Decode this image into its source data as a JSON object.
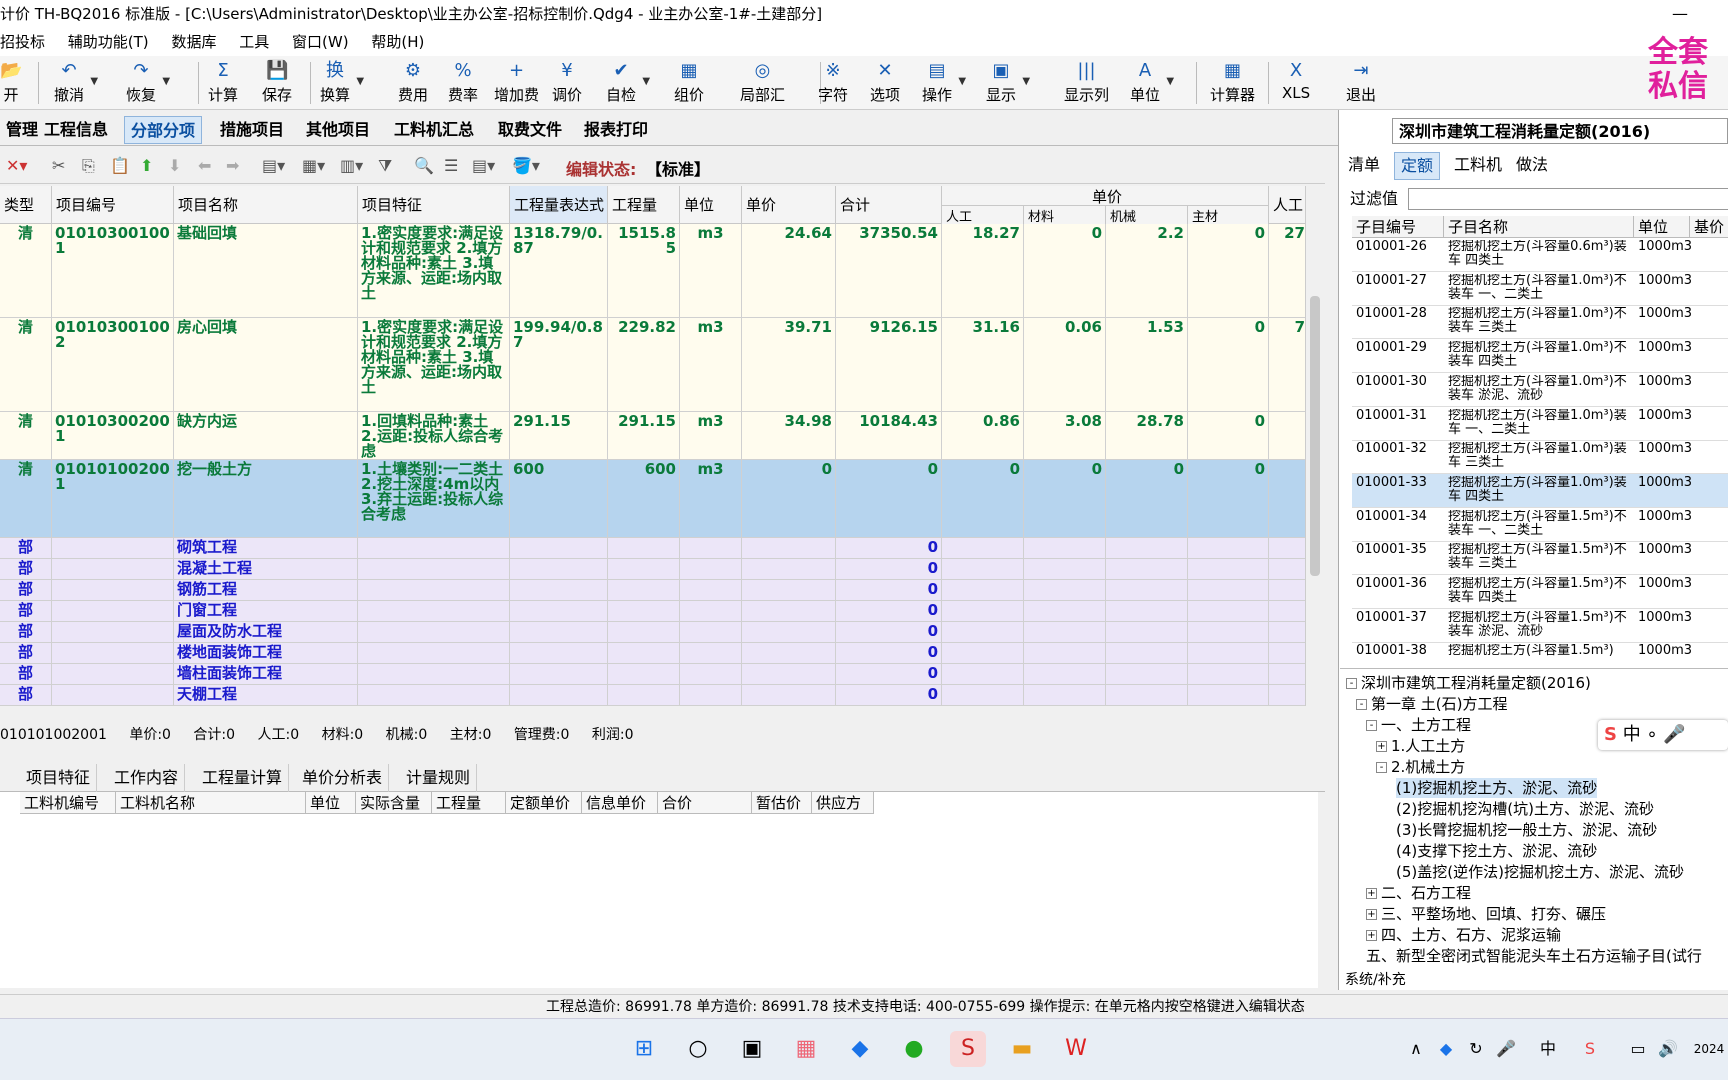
{
  "title": "计价 TH-BQ2016 标准版 - [C:\\Users\\Administrator\\Desktop\\业主办公室-招标控制价.Qdg4 - 业主办公室-1#-土建部分]",
  "menu": [
    "招投标",
    "辅助功能(T)",
    "数据库",
    "工具",
    "窗口(W)",
    "帮助(H)"
  ],
  "toolbar": [
    {
      "label": "开",
      "icon": "📂"
    },
    {
      "label": "撤消",
      "icon": "↶"
    },
    {
      "label": "恢复",
      "icon": "↷"
    },
    {
      "label": "计算",
      "icon": "Σ"
    },
    {
      "label": "保存",
      "icon": "💾"
    },
    {
      "label": "换算",
      "icon": "换"
    },
    {
      "label": "费用",
      "icon": "⚙"
    },
    {
      "label": "费率",
      "icon": "%"
    },
    {
      "label": "增加费",
      "icon": "+"
    },
    {
      "label": "调价",
      "icon": "¥"
    },
    {
      "label": "自检",
      "icon": "✔"
    },
    {
      "label": "组价",
      "icon": "▦"
    },
    {
      "label": "局部汇",
      "icon": "◎"
    },
    {
      "label": "字符",
      "icon": "※"
    },
    {
      "label": "选项",
      "icon": "✕"
    },
    {
      "label": "操作",
      "icon": "▤"
    },
    {
      "label": "显示",
      "icon": "▣"
    },
    {
      "label": "显示列",
      "icon": "|||"
    },
    {
      "label": "单位",
      "icon": "A"
    },
    {
      "label": "计算器",
      "icon": "▦"
    },
    {
      "label": "XLS",
      "icon": "X"
    },
    {
      "label": "退出",
      "icon": "⇥"
    }
  ],
  "promo": "全套私信",
  "tabs": [
    "管理",
    "工程信息",
    "分部分项",
    "措施项目",
    "其他项目",
    "工料机汇总",
    "取费文件",
    "报表打印"
  ],
  "edit_status_label": "编辑状态:",
  "edit_status_value": "【标准】",
  "grid_headers": [
    "类型",
    "项目编号",
    "项目名称",
    "项目特征",
    "工程量表达式",
    "工程量",
    "单位",
    "单价",
    "合计",
    "单价",
    "人工",
    "材料",
    "机械",
    "主材",
    "人工"
  ],
  "rows": [
    {
      "type": "清",
      "code": "010103001001",
      "name": "基础回填",
      "feature": "1.密实度要求:满足设计和规范要求 2.填方材料品种:素土 3.填方来源、运距:场内取土",
      "expr": "1318.79/0.87",
      "qty": "1515.85",
      "unit": "m3",
      "price": "24.64",
      "total": "37350.54",
      "labor": "18.27",
      "material": "0",
      "machine": "2.2",
      "main": "0",
      "lab2": "27"
    },
    {
      "type": "清",
      "code": "010103001002",
      "name": "房心回填",
      "feature": "1.密实度要求:满足设计和规范要求 2.填方材料品种:素土 3.填方来源、运距:场内取土",
      "expr": "199.94/0.87",
      "qty": "229.82",
      "unit": "m3",
      "price": "39.71",
      "total": "9126.15",
      "labor": "31.16",
      "material": "0.06",
      "machine": "1.53",
      "main": "0",
      "lab2": "7"
    },
    {
      "type": "清",
      "code": "010103002001",
      "name": "缺方内运",
      "feature": "1.回填料品种:素土 2.运距:投标人综合考虑",
      "expr": "291.15",
      "qty": "291.15",
      "unit": "m3",
      "price": "34.98",
      "total": "10184.43",
      "labor": "0.86",
      "material": "3.08",
      "machine": "28.78",
      "main": "0",
      "lab2": ""
    },
    {
      "type": "清",
      "code": "010101002001",
      "name": "挖一般土方",
      "feature": "1.土壤类别:一二类土 2.挖土深度:4m以内 3.弃土运距:投标人综合考虑",
      "expr": "600",
      "qty": "600",
      "unit": "m3",
      "price": "0",
      "total": "0",
      "labor": "0",
      "material": "0",
      "machine": "0",
      "main": "0",
      "lab2": ""
    }
  ],
  "sections": [
    {
      "type": "部",
      "name": "砌筑工程",
      "total": "0"
    },
    {
      "type": "部",
      "name": "混凝土工程",
      "total": "0"
    },
    {
      "type": "部",
      "name": "钢筋工程",
      "total": "0"
    },
    {
      "type": "部",
      "name": "门窗工程",
      "total": "0"
    },
    {
      "type": "部",
      "name": "屋面及防水工程",
      "total": "0"
    },
    {
      "type": "部",
      "name": "楼地面装饰工程",
      "total": "0"
    },
    {
      "type": "部",
      "name": "墙柱面装饰工程",
      "total": "0"
    },
    {
      "type": "部",
      "name": "天棚工程",
      "total": "0"
    }
  ],
  "summary": [
    "010101002001",
    "单价:0",
    "合计:0",
    "人工:0",
    "材料:0",
    "机械:0",
    "主材:0",
    "管理费:0",
    "利润:0"
  ],
  "subtabs": [
    "项目特征",
    "工作内容",
    "工程量计算",
    "单价分析表",
    "计量规则"
  ],
  "subgrid_headers": [
    "工料机编号",
    "工料机名称",
    "单位",
    "实际含量",
    "工程量",
    "定额单价",
    "信息单价",
    "合价",
    "暂估价",
    "供应方"
  ],
  "right": {
    "title": "深圳市建筑工程消耗量定额(2016)",
    "tabs": [
      "清单",
      "定额",
      "工料机",
      "做法"
    ],
    "filter_label": "过滤值",
    "headers": [
      "子目编号",
      "子目名称",
      "单位",
      "基价"
    ],
    "rows": [
      {
        "code": "010001-26",
        "name": "挖掘机挖土方(斗容量0.6m³)装车 四类土",
        "unit": "1000m3"
      },
      {
        "code": "010001-27",
        "name": "挖掘机挖土方(斗容量1.0m³)不装车 一、二类土",
        "unit": "1000m3"
      },
      {
        "code": "010001-28",
        "name": "挖掘机挖土方(斗容量1.0m³)不装车 三类土",
        "unit": "1000m3"
      },
      {
        "code": "010001-29",
        "name": "挖掘机挖土方(斗容量1.0m³)不装车 四类土",
        "unit": "1000m3"
      },
      {
        "code": "010001-30",
        "name": "挖掘机挖土方(斗容量1.0m³)不装车 淤泥、流砂",
        "unit": "1000m3"
      },
      {
        "code": "010001-31",
        "name": "挖掘机挖土方(斗容量1.0m³)装车 一、二类土",
        "unit": "1000m3"
      },
      {
        "code": "010001-32",
        "name": "挖掘机挖土方(斗容量1.0m³)装车 三类土",
        "unit": "1000m3"
      },
      {
        "code": "010001-33",
        "name": "挖掘机挖土方(斗容量1.0m³)装车 四类土",
        "unit": "1000m3"
      },
      {
        "code": "010001-34",
        "name": "挖掘机挖土方(斗容量1.5m³)不装车 一、二类土",
        "unit": "1000m3"
      },
      {
        "code": "010001-35",
        "name": "挖掘机挖土方(斗容量1.5m³)不装车 三类土",
        "unit": "1000m3"
      },
      {
        "code": "010001-36",
        "name": "挖掘机挖土方(斗容量1.5m³)不装车 四类土",
        "unit": "1000m3"
      },
      {
        "code": "010001-37",
        "name": "挖掘机挖土方(斗容量1.5m³)不装车 淤泥、流砂",
        "unit": "1000m3"
      },
      {
        "code": "010001-38",
        "name": "挖掘机挖土方(斗容量1.5m³)",
        "unit": "1000m3"
      }
    ],
    "tree": [
      {
        "label": "深圳市建筑工程消耗量定额(2016)",
        "pm": "-"
      },
      {
        "label": "第一章 土(石)方工程",
        "pm": "-"
      },
      {
        "label": "一、土方工程",
        "pm": "-"
      },
      {
        "label": "1.人工土方",
        "pm": "+"
      },
      {
        "label": "2.机械土方",
        "pm": "-"
      },
      {
        "label": "(1)挖掘机挖土方、淤泥、流砂",
        "pm": ""
      },
      {
        "label": "(2)挖掘机挖沟槽(坑)土方、淤泥、流砂",
        "pm": ""
      },
      {
        "label": "(3)长臂挖掘机挖一般土方、淤泥、流砂",
        "pm": ""
      },
      {
        "label": "(4)支撑下挖土方、淤泥、流砂",
        "pm": ""
      },
      {
        "label": "(5)盖挖(逆作法)挖掘机挖土方、淤泥、流砂",
        "pm": ""
      },
      {
        "label": "二、石方工程",
        "pm": "+"
      },
      {
        "label": "三、平整场地、回填、打夯、碾压",
        "pm": "+"
      },
      {
        "label": "四、土方、石方、泥浆运输",
        "pm": "+"
      },
      {
        "label": "五、新型全密闭式智能泥头车土石方运输子目(试行",
        "pm": ""
      }
    ],
    "tree_tabs": "系统/补充"
  },
  "ime": "中",
  "status": "工程总造价: 86991.78    单方造价: 86991.78    技术支持电话: 400-0755-699    操作提示: 在单元格内按空格键进入编辑状态",
  "clock": "2024"
}
